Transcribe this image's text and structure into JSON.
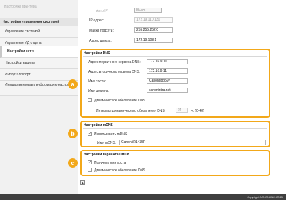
{
  "sidebar": {
    "top_link": "Настройка принтера",
    "section_header": "Настройки управления системой",
    "items": [
      {
        "label": "Управление системой"
      },
      {
        "label": "Управление ИД отдела"
      },
      {
        "label": "Настройки сети"
      },
      {
        "label": "Настройки защиты"
      },
      {
        "label": "Импорт/Экспорт"
      },
      {
        "label": "Инициализировать информацию настроек"
      }
    ]
  },
  "top_form": {
    "auto_ip_label": "Авто IP:",
    "auto_ip_value": "Выкл.",
    "ip_label": "IP-адрес:",
    "ip_value": "172.19.110.130",
    "mask_label": "Маска подсети:",
    "mask_value": "255.255.252.0",
    "gateway_label": "Адрес шлюза:",
    "gateway_value": "172.19.108.1"
  },
  "dns": {
    "title": "Настройки DNS",
    "primary_label": "Адрес первичного сервера DNS:",
    "primary_value": "172.16.9.10",
    "secondary_label": "Адрес вторичного сервера DNS:",
    "secondary_value": "172.16.9.11",
    "host_label": "Имя хоста:",
    "host_value": "Canondbb597",
    "domain_label": "Имя домена:",
    "domain_value": "canonintra.net",
    "dynamic_label": "Динамическое обновление DNS",
    "interval_label": "Интервал динамического обновления DNS:",
    "interval_value": "24",
    "interval_unit": "ч. (0-48)"
  },
  "mdns": {
    "title": "Настройки mDNS",
    "use_label": "Использовать mDNS",
    "name_label": "Имя mDNS:",
    "name_value": "Canon iR1435P"
  },
  "dhcp": {
    "title": "Настройки варианта DHCP",
    "host_label": "Получить имя хоста",
    "dynamic_label": "Динамическое обновление DNS"
  },
  "callouts": {
    "a": "a",
    "b": "b",
    "c": "c"
  },
  "scroll_top_glyph": "▲",
  "footer": {
    "copyright": "Copyright CANON INC. 2015"
  }
}
